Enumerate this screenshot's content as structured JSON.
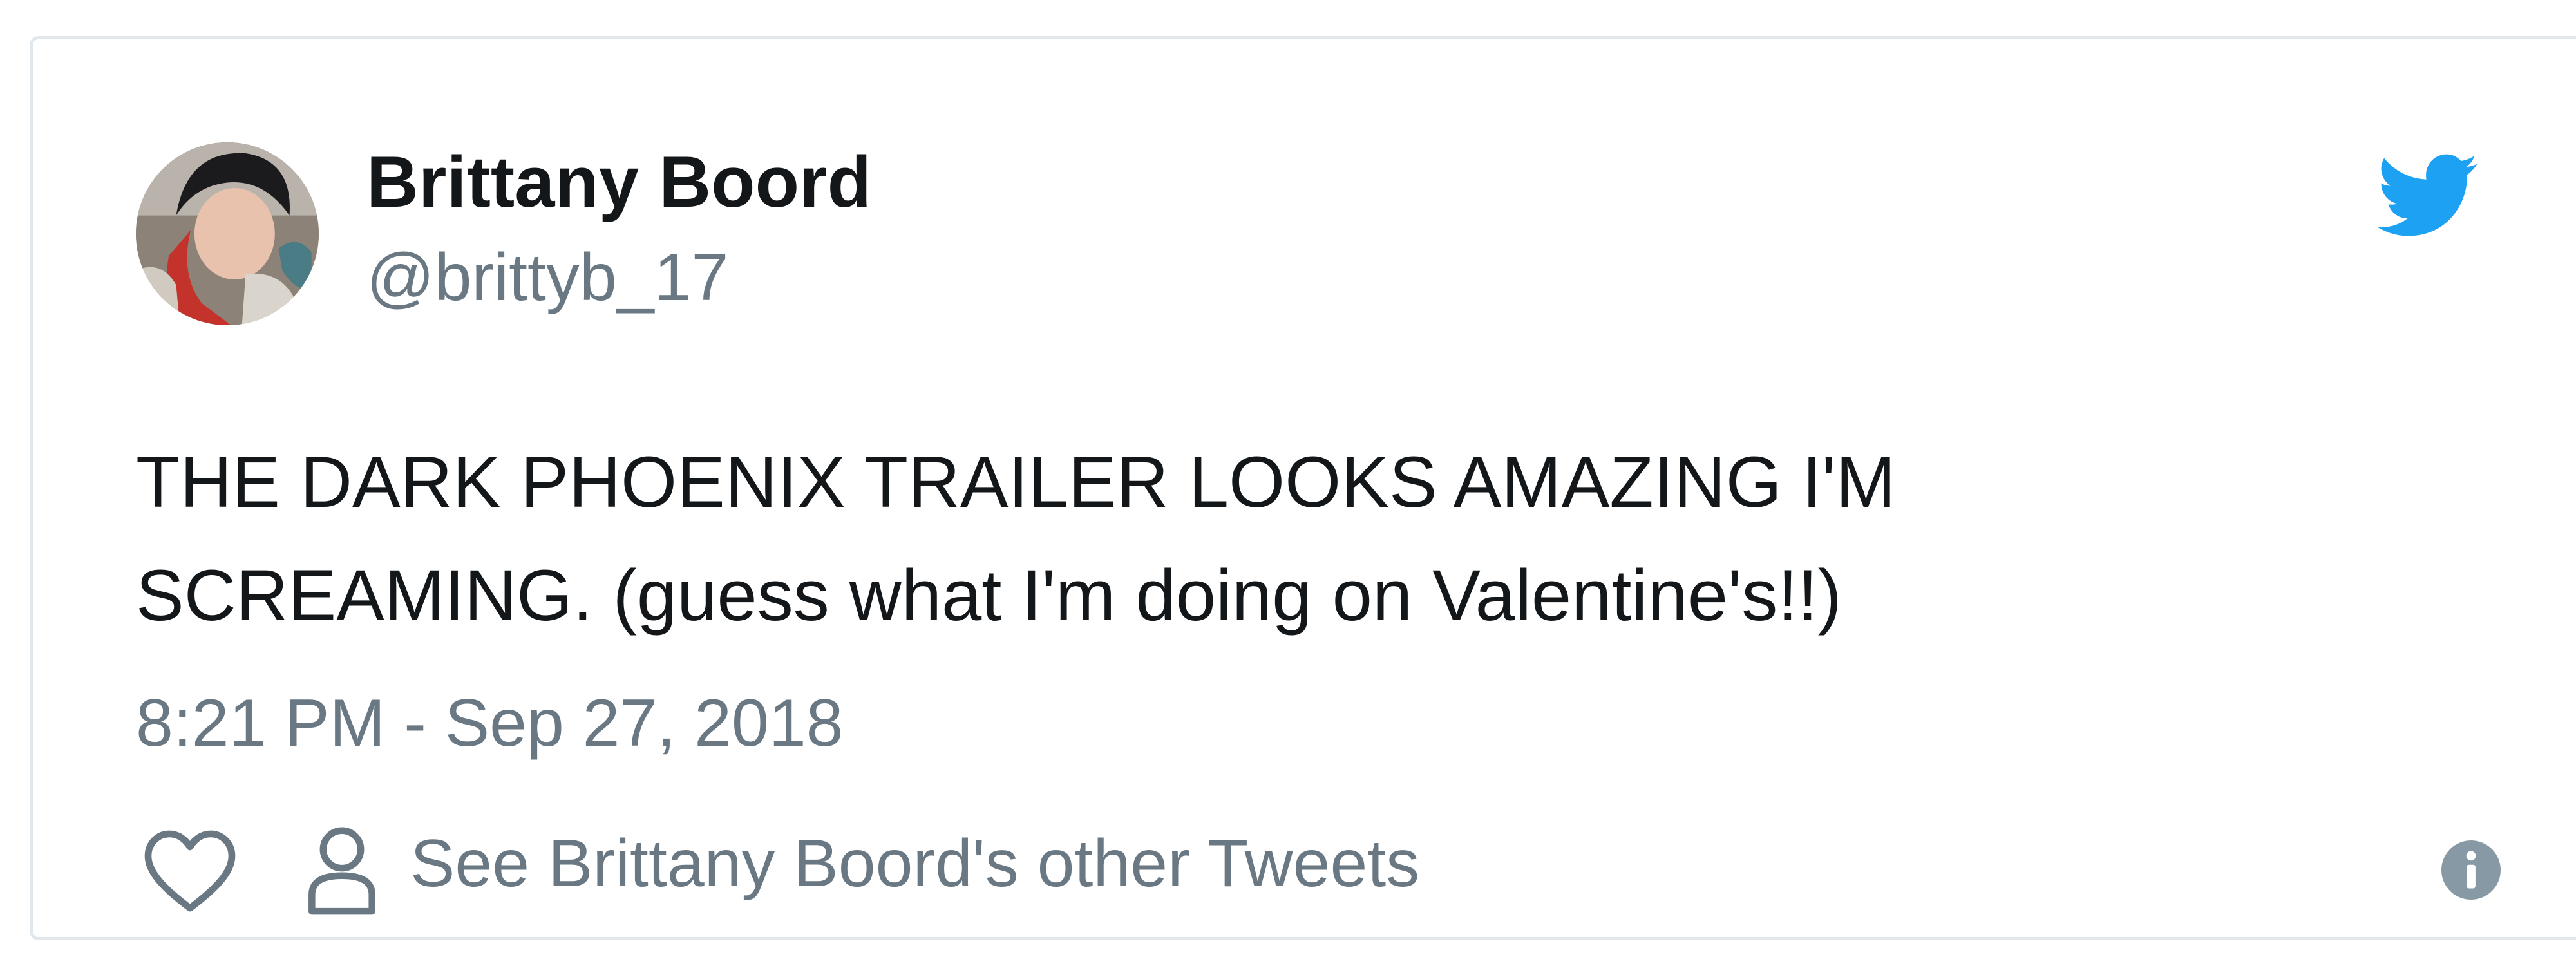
{
  "tweet": {
    "author": {
      "display_name": "Brittany Boord",
      "screen_name": "@brittyb_17",
      "avatar_icon": "profile-photo"
    },
    "brand_icon": "twitter-bird-icon",
    "text": "THE DARK PHOENIX TRAILER LOOKS AMAZING I'M\nSCREAMING. (guess what I'm doing on Valentine's!!)",
    "timestamp": "8:21 PM - Sep 27, 2018",
    "actions": {
      "like_icon": "heart-icon",
      "profile_icon": "person-icon",
      "other_tweets_label": "See Brittany Boord's other Tweets",
      "info_icon": "info-icon"
    }
  },
  "colors": {
    "text_primary": "#14171a",
    "text_secondary": "#697882",
    "twitter_blue": "#1da1f2",
    "card_border": "#e1e8ed"
  }
}
